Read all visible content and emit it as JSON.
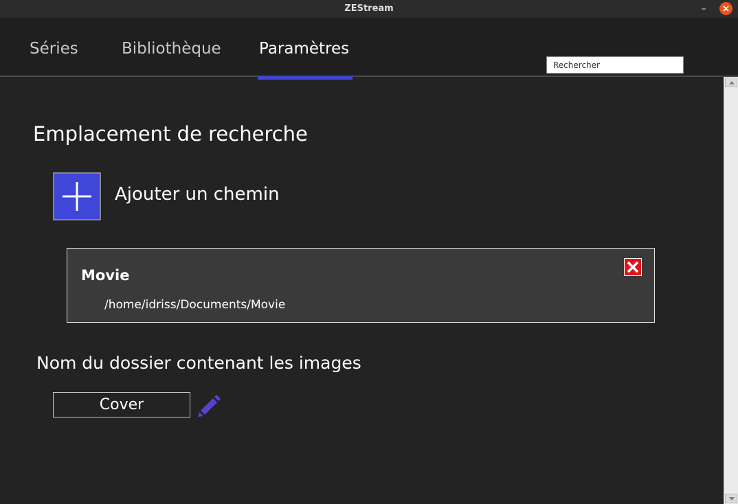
{
  "window": {
    "title": "ZEStream",
    "minimize_glyph": "–",
    "close_icon": "close-icon"
  },
  "nav": {
    "tabs": [
      {
        "label": "Séries",
        "active": false
      },
      {
        "label": "Bibliothèque",
        "active": false
      },
      {
        "label": "Paramètres",
        "active": true
      }
    ],
    "search_placeholder": "Rechercher",
    "accent_color": "#3f46d8"
  },
  "settings": {
    "search_location_title": "Emplacement de recherche",
    "add_path_label": "Ajouter un chemin",
    "paths": [
      {
        "name": "Movie",
        "path": "/home/idriss/Documents/Movie"
      }
    ],
    "image_folder_title": "Nom du dossier contenant les images",
    "image_folder_value": "Cover"
  },
  "colors": {
    "background": "#232323",
    "card": "#3a3a3a",
    "delete": "#e0141b",
    "edit_icon": "#5a3fd0"
  }
}
